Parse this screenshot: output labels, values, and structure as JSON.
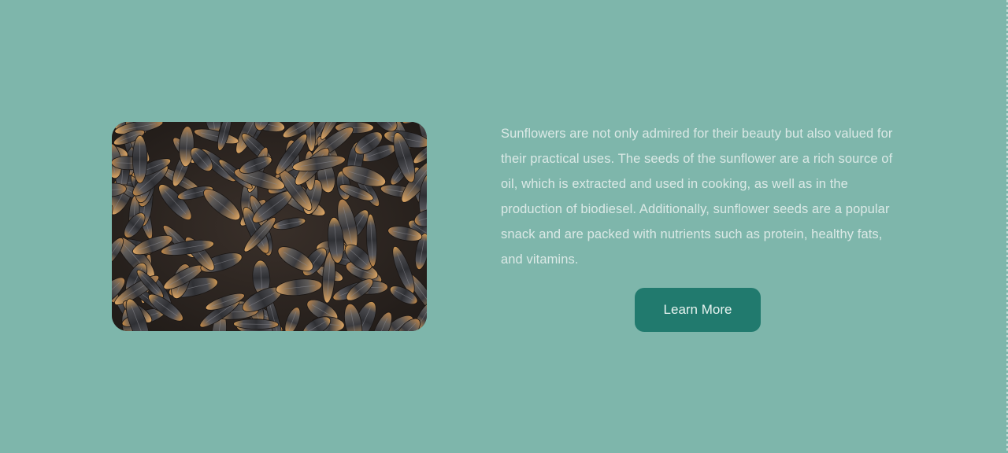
{
  "feature": {
    "image": {
      "alt": "Sunflower seeds close-up",
      "icon": "sunflower-seeds-photo"
    },
    "description": "Sunflowers are not only admired for their beauty but also valued for their practical uses. The seeds of the sunflower are a rich source of oil, which is extracted and used in cooking, as well as in the production of biodiesel. Additionally, sunflower seeds are a popular snack and are packed with nutrients such as protein, healthy fats, and vitamins.",
    "button_label": "Learn More"
  },
  "colors": {
    "background": "#7eb6ab",
    "button": "#217a6e",
    "text": "#dbe9e6"
  }
}
